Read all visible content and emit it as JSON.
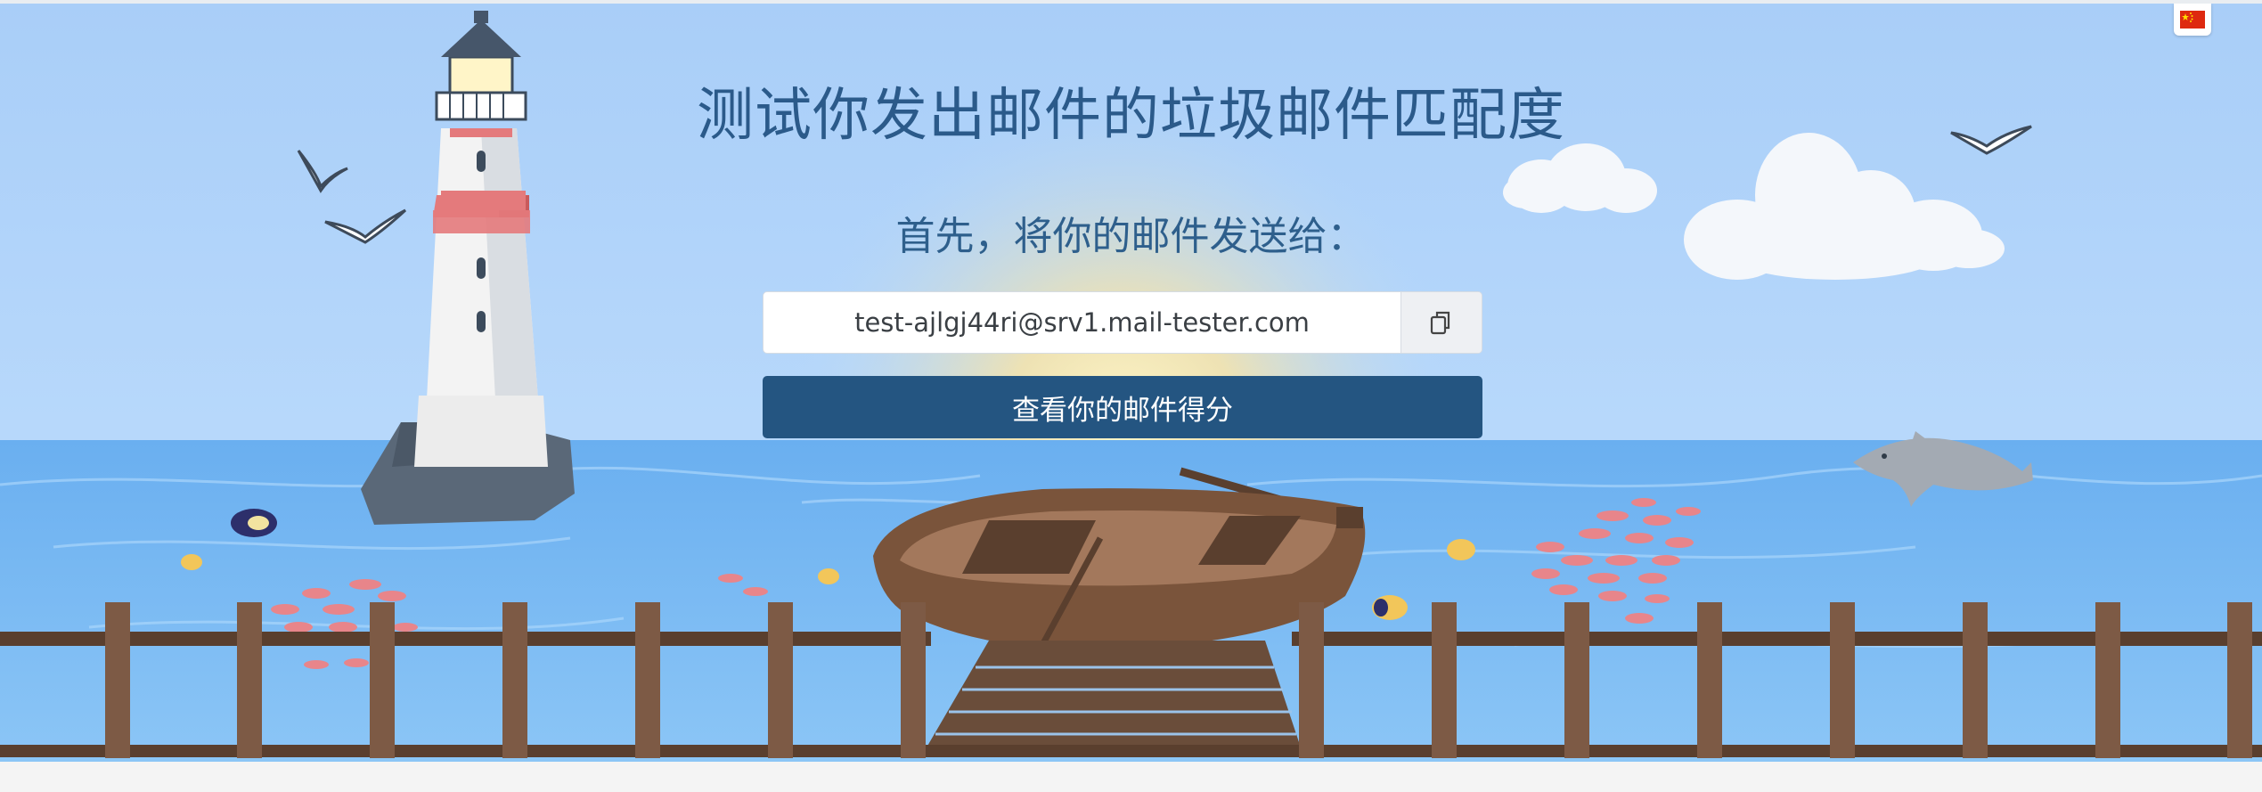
{
  "hero": {
    "title": "测试你发出邮件的垃圾邮件匹配度",
    "subtitle": "首先，将你的邮件发送给：",
    "email_address": "test-ajlgj44ri@srv1.mail-tester.com",
    "copy_icon": "copy-icon",
    "score_button_label": "查看你的邮件得分"
  },
  "language": {
    "flag_icon": "china-flag-icon"
  },
  "colors": {
    "sky": "#a9cef8",
    "sea": "#6fb4f2",
    "button": "#245581",
    "title_text": "#2b5a8a",
    "fence": "#7a5a43"
  }
}
